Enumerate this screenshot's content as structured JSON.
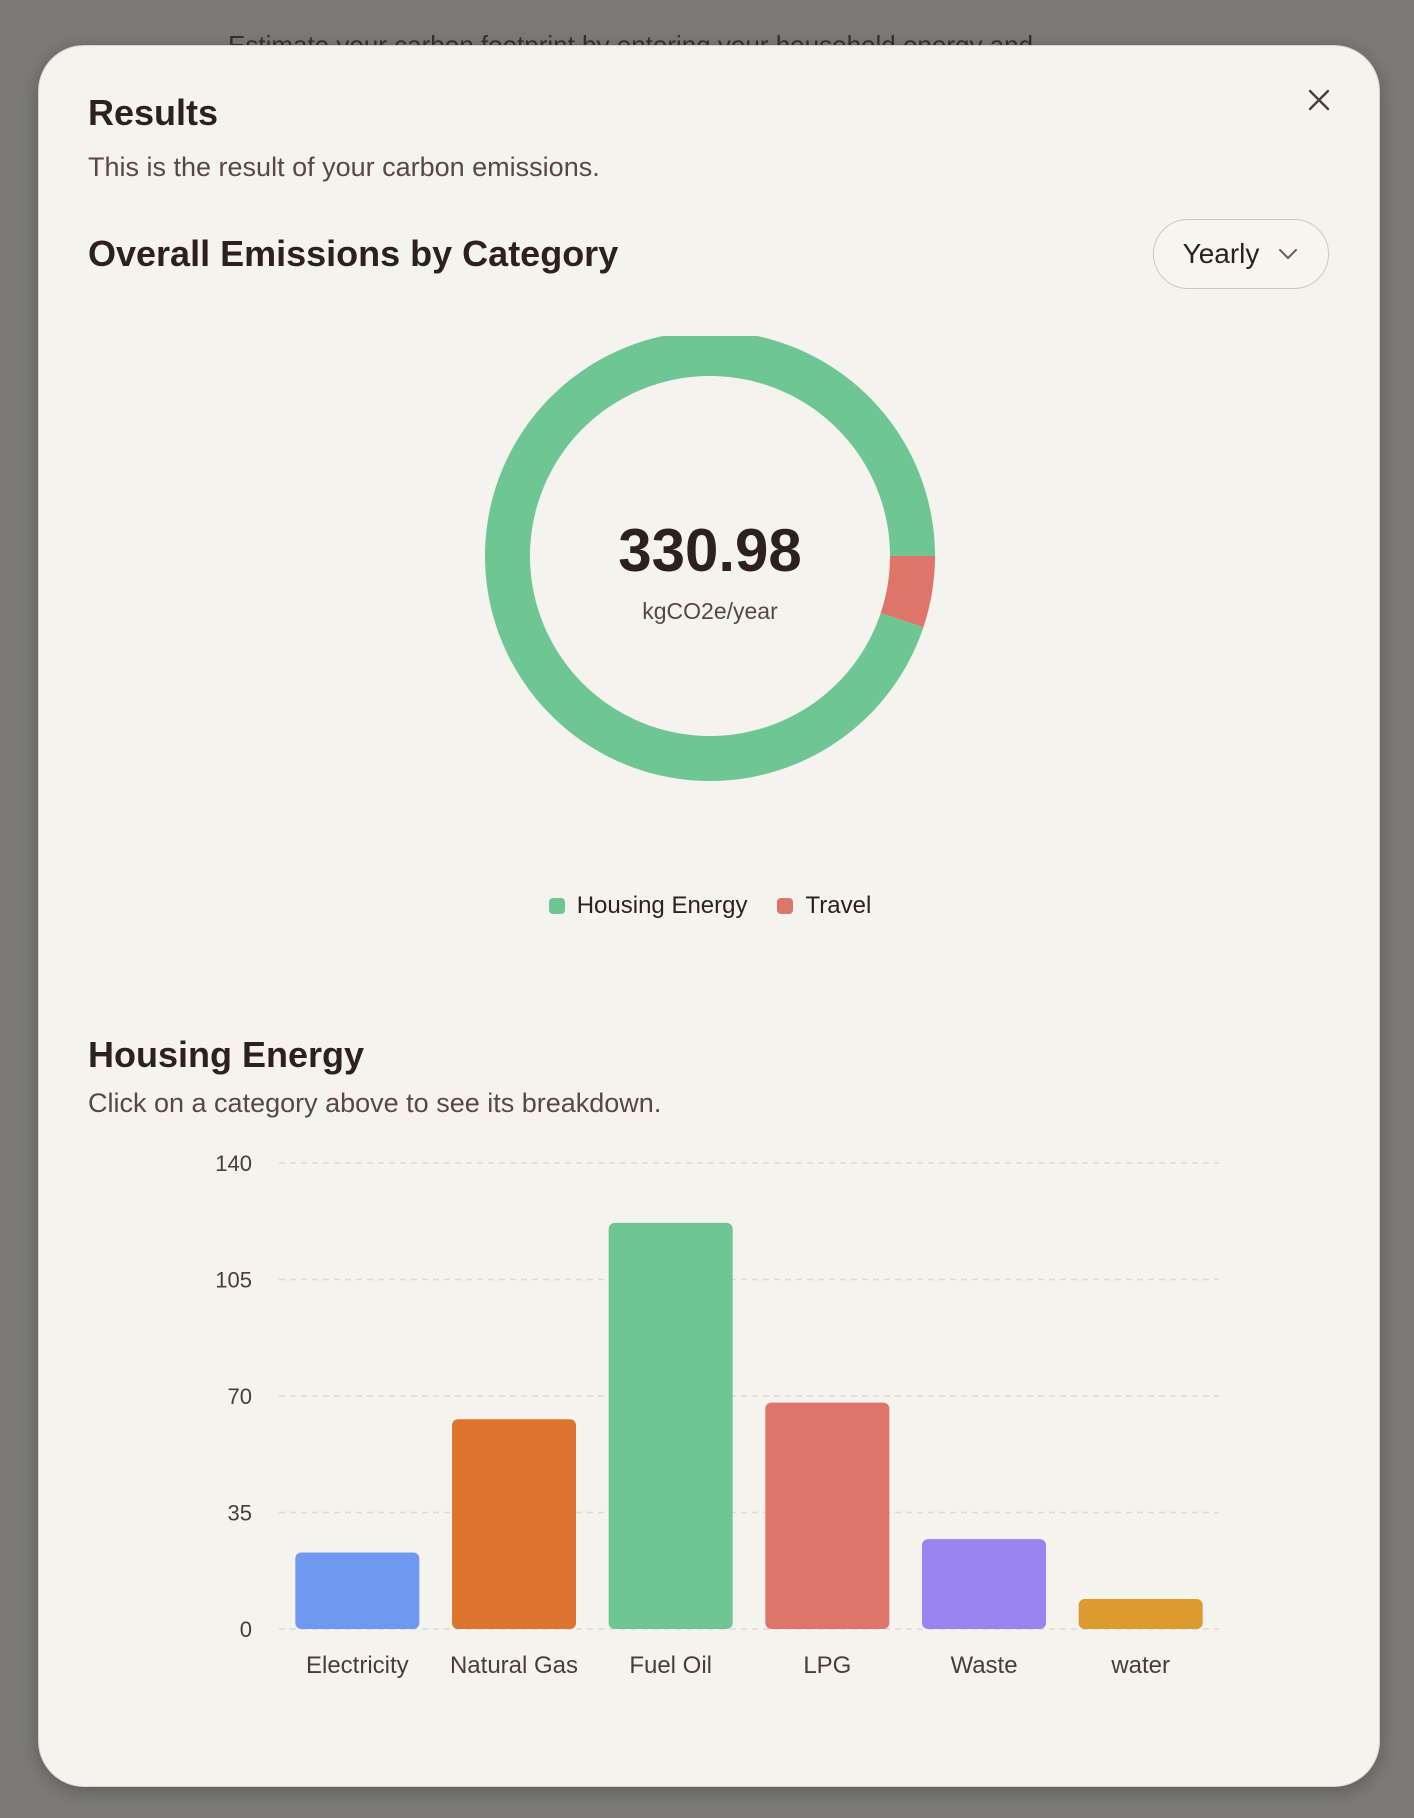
{
  "background": {
    "partial_text": "Estimate your carbon footprint by entering your household energy and"
  },
  "modal": {
    "title": "Results",
    "subtitle": "This is the result of your carbon emissions.",
    "close_icon": "close-icon"
  },
  "overview": {
    "title": "Overall Emissions by Category",
    "period_select": {
      "value": "Yearly",
      "icon": "chevron-down-icon"
    },
    "total_value": "330.98",
    "total_unit": "kgCO2e/year"
  },
  "breakdown": {
    "title": "Housing Energy",
    "subtitle": "Click on a category above to see its breakdown."
  },
  "colors": {
    "housing": "#6ec793",
    "travel": "#dd756b",
    "electricity": "#6f98f1",
    "natural_gas": "#dc752e",
    "fuel_oil": "#6ec793",
    "lpg": "#dd756b",
    "waste": "#9a85f0",
    "water": "#dd9a30"
  },
  "chart_data": [
    {
      "type": "pie",
      "donut": true,
      "categories": [
        "Housing Energy",
        "Travel"
      ],
      "values": [
        314.0,
        16.98
      ],
      "colors": [
        "#6ec793",
        "#dd756b"
      ],
      "legend": "bottom-center"
    },
    {
      "type": "bar",
      "categories": [
        "Electricity",
        "Natural Gas",
        "Fuel Oil",
        "LPG",
        "Waste",
        "water"
      ],
      "values": [
        23,
        63,
        122,
        68,
        27,
        9
      ],
      "colors": [
        "#6f98f1",
        "#dc752e",
        "#6ec793",
        "#dd756b",
        "#9a85f0",
        "#dd9a30"
      ],
      "ylim": [
        0,
        140
      ],
      "yticks": [
        "0",
        "35",
        "70",
        "105",
        "140"
      ],
      "grid": true
    }
  ]
}
